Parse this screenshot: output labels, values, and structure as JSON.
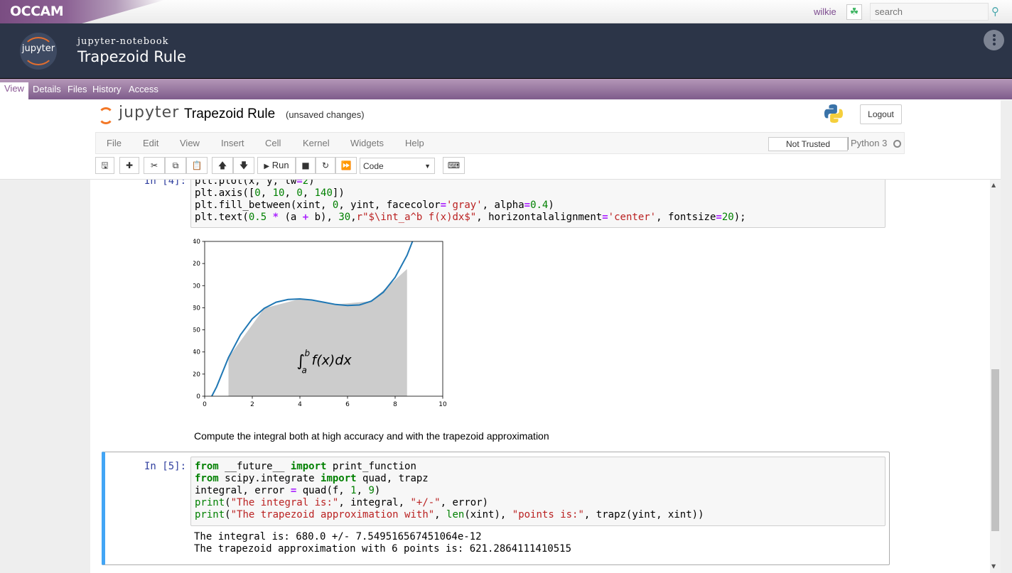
{
  "occam": {
    "brand": "OCCAM",
    "user": "wilkie",
    "search_placeholder": "search"
  },
  "object": {
    "type": "jupyter-notebook",
    "title": "Trapezoid Rule"
  },
  "tabs": [
    "View",
    "Details",
    "Files",
    "History",
    "Access"
  ],
  "notebook": {
    "logo_text": "jupyter",
    "title": "Trapezoid Rule",
    "status": "(unsaved changes)",
    "logout": "Logout",
    "menu": [
      "File",
      "Edit",
      "View",
      "Insert",
      "Cell",
      "Kernel",
      "Widgets",
      "Help"
    ],
    "trust": "Not Trusted",
    "kernel": "Python 3",
    "run_label": "Run",
    "cell_type": "Code"
  },
  "cells": {
    "cell4_prompt": "In [4]:",
    "cell5_prompt": "In [5]:",
    "markdown": "Compute the integral both at high accuracy and with the trapezoid approximation",
    "output_line1": "The integral is: 680.0 +/- 7.549516567451064e-12",
    "output_line2": "The trapezoid approximation with 6 points is: 621.2864111410515"
  },
  "chart_data": {
    "type": "line",
    "title": "",
    "xlabel": "",
    "ylabel": "",
    "xlim": [
      0,
      10
    ],
    "ylim": [
      0,
      140
    ],
    "x_ticks": [
      0,
      2,
      4,
      6,
      8,
      10
    ],
    "y_ticks": [
      0,
      20,
      40,
      60,
      80,
      100,
      120,
      140
    ],
    "annotation": "∫_a^b f(x)dx",
    "series": [
      {
        "color": "#1f77b4",
        "x": [
          0.3,
          0.5,
          1,
          1.5,
          2,
          2.5,
          3,
          3.5,
          4,
          4.5,
          5,
          5.5,
          6,
          6.5,
          7,
          7.5,
          8,
          8.5,
          9,
          9.2
        ],
        "y": [
          0,
          8.5,
          35,
          55.5,
          70,
          79.5,
          85,
          87.5,
          88,
          87,
          85,
          83,
          82,
          82.5,
          86,
          94,
          107.5,
          127.5,
          155,
          168.4
        ]
      }
    ],
    "fill": {
      "color": "gray",
      "alpha": 0.4,
      "x": [
        1,
        2.5,
        4,
        5.5,
        7,
        8.5
      ],
      "y": [
        35,
        79.5,
        88,
        83,
        86,
        115
      ]
    }
  }
}
